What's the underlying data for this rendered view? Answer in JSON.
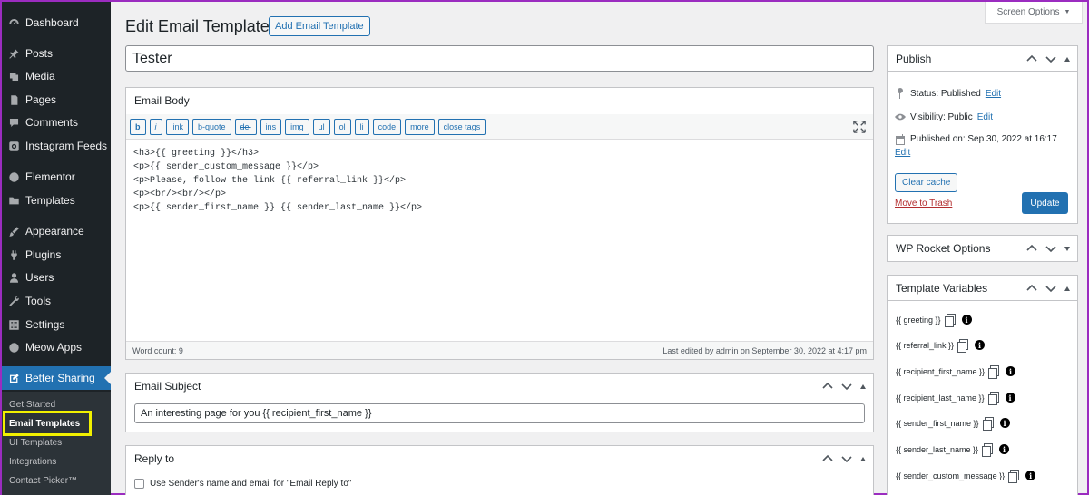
{
  "sidebar": {
    "items": [
      {
        "label": "Dashboard",
        "icon": "dashboard-icon"
      },
      {
        "label": "Posts",
        "icon": "pin-icon"
      },
      {
        "label": "Media",
        "icon": "media-icon"
      },
      {
        "label": "Pages",
        "icon": "pages-icon"
      },
      {
        "label": "Comments",
        "icon": "comments-icon"
      },
      {
        "label": "Instagram Feeds",
        "icon": "instagram-icon"
      },
      {
        "label": "Elementor",
        "icon": "elementor-icon"
      },
      {
        "label": "Templates",
        "icon": "folder-icon"
      },
      {
        "label": "Appearance",
        "icon": "brush-icon"
      },
      {
        "label": "Plugins",
        "icon": "plugin-icon"
      },
      {
        "label": "Users",
        "icon": "user-icon"
      },
      {
        "label": "Tools",
        "icon": "wrench-icon"
      },
      {
        "label": "Settings",
        "icon": "settings-icon"
      },
      {
        "label": "Meow Apps",
        "icon": "meow-icon"
      },
      {
        "label": "Better Sharing",
        "icon": "edit-icon"
      }
    ],
    "submenu": [
      "Get Started",
      "Email Templates",
      "UI Templates",
      "Integrations",
      "Contact Picker™"
    ],
    "highlight_color": "#f1f000"
  },
  "header": {
    "title": "Edit Email Template",
    "add_button": "Add Email Template",
    "screen_options": "Screen Options",
    "screen_options_arrow": "▼"
  },
  "post_title": "Tester",
  "email_body": {
    "title": "Email Body",
    "quicktags": [
      "b",
      "i",
      "link",
      "b-quote",
      "del",
      "ins",
      "img",
      "ul",
      "ol",
      "li",
      "code",
      "more",
      "close tags"
    ],
    "content": "<h3>{{ greeting }}</h3>\n<p>{{ sender_custom_message }}</p>\n<p>Please, follow the link {{ referral_link }}</p>\n<p><br/><br/></p>\n<p>{{ sender_first_name }} {{ sender_last_name }}</p>",
    "word_count": "Word count: 9",
    "last_edited": "Last edited by admin on September 30, 2022 at 4:17 pm"
  },
  "email_subject": {
    "title": "Email Subject",
    "value": "An interesting page for you {{ recipient_first_name }}"
  },
  "reply_to": {
    "title": "Reply to",
    "checkbox_label": "Use Sender's name and email for \"Email Reply to\""
  },
  "publish": {
    "title": "Publish",
    "status_label": "Status: Published",
    "visibility_label": "Visibility: Public",
    "published_on_label": "Published on: Sep 30, 2022 at 16:17",
    "edit_link": "Edit",
    "clear_cache": "Clear cache",
    "move_to_trash": "Move to Trash",
    "update": "Update"
  },
  "wp_rocket": {
    "title": "WP Rocket Options"
  },
  "template_variables": {
    "title": "Template Variables",
    "items": [
      "{{ greeting }}",
      "{{ referral_link }}",
      "{{ recipient_first_name }}",
      "{{ recipient_last_name }}",
      "{{ sender_first_name }}",
      "{{ sender_last_name }}",
      "{{ sender_custom_message }}"
    ]
  },
  "colors": {
    "accent": "#2271b1",
    "sidebar": "#1d2327",
    "border": "#9b2cc0"
  }
}
